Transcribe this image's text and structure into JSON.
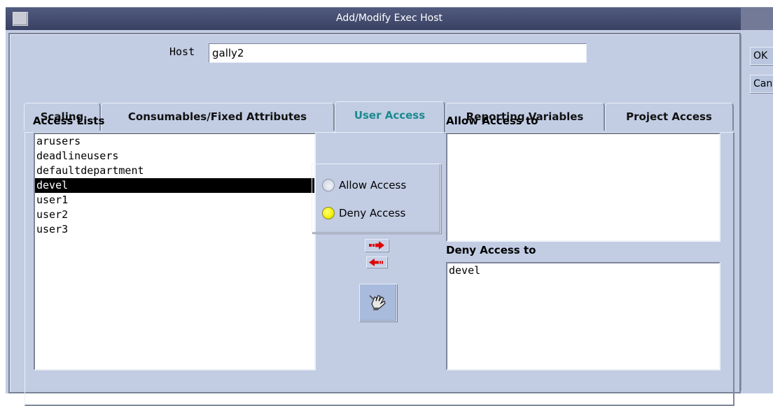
{
  "window": {
    "title": "Add/Modify Exec Host"
  },
  "host": {
    "label": "Host",
    "value": "gally2"
  },
  "side_buttons": {
    "ok_label": "OK",
    "cancel_label": "Cancel"
  },
  "tabs": [
    {
      "label": "Scaling"
    },
    {
      "label": "Consumables/Fixed Attributes"
    },
    {
      "label": "User Access",
      "active": true
    },
    {
      "label": "Reporting Variables"
    },
    {
      "label": "Project Access"
    }
  ],
  "access_lists": {
    "label": "Access Lists",
    "items": [
      "arusers",
      "deadlineusers",
      "defaultdepartment",
      "devel",
      "user1",
      "user2",
      "user3"
    ],
    "selected": "devel"
  },
  "access_mode": {
    "options": [
      "Allow Access",
      "Deny Access"
    ],
    "selected": "Deny Access"
  },
  "allow_access": {
    "label": "Allow Access to",
    "items": []
  },
  "deny_access": {
    "label": "Deny Access to",
    "items": [
      "devel"
    ]
  },
  "icons": {
    "add": "arrow-right-icon",
    "remove": "arrow-left-icon",
    "edit": "hand-edit-icon"
  },
  "colors": {
    "background": "#c2cde4",
    "active_tab": "#1a8a8e",
    "selected_radio": "#f2f000",
    "arrow": "#e00000"
  }
}
